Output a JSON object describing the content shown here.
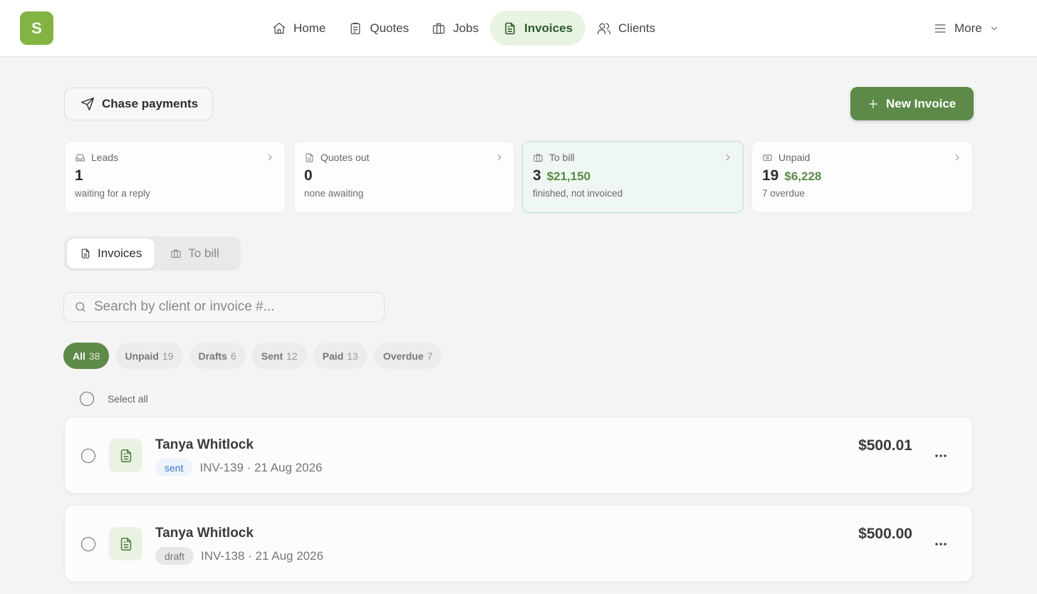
{
  "app": {
    "logo_letter": "S",
    "brand_color": "#83b443",
    "accent": "#5d8a48"
  },
  "nav": {
    "items": [
      {
        "label": "Home",
        "icon": "home-icon"
      },
      {
        "label": "Quotes",
        "icon": "clipboard-icon"
      },
      {
        "label": "Jobs",
        "icon": "briefcase-icon"
      },
      {
        "label": "Invoices",
        "icon": "invoice-icon",
        "active": true
      },
      {
        "label": "Clients",
        "icon": "users-icon"
      }
    ],
    "more_label": "More"
  },
  "actions": {
    "chase_label": "Chase payments",
    "new_invoice_label": "New Invoice"
  },
  "stats": [
    {
      "label": "Leads",
      "icon": "inbox-icon",
      "count": "1",
      "amount": "",
      "sub": "waiting for a reply"
    },
    {
      "label": "Quotes out",
      "icon": "document-icon",
      "count": "0",
      "amount": "",
      "sub": "none awaiting"
    },
    {
      "label": "To bill",
      "icon": "briefcase-icon",
      "count": "3",
      "amount": "$21,150",
      "sub": "finished, not invoiced",
      "highlighted": true
    },
    {
      "label": "Unpaid",
      "icon": "cash-icon",
      "count": "19",
      "amount": "$6,228",
      "sub": "7 overdue"
    }
  ],
  "tabs": [
    {
      "label": "Invoices",
      "icon": "invoice-icon",
      "active": true
    },
    {
      "label": "To bill",
      "icon": "briefcase-icon"
    }
  ],
  "search": {
    "placeholder": "Search by client or invoice #...",
    "value": ""
  },
  "filters": [
    {
      "label": "All",
      "count": "38",
      "active": true
    },
    {
      "label": "Unpaid",
      "count": "19"
    },
    {
      "label": "Drafts",
      "count": "6"
    },
    {
      "label": "Sent",
      "count": "12"
    },
    {
      "label": "Paid",
      "count": "13"
    },
    {
      "label": "Overdue",
      "count": "7"
    }
  ],
  "select_all_label": "Select all",
  "invoices": [
    {
      "client": "Tanya Whitlock",
      "status": "sent",
      "number": "INV-139",
      "date": "21 Aug 2026",
      "meta": "INV-139 · 21 Aug 2026",
      "amount": "$500.01"
    },
    {
      "client": "Tanya Whitlock",
      "status": "draft",
      "number": "INV-138",
      "date": "21 Aug 2026",
      "meta": "INV-138 · 21 Aug 2026",
      "amount": "$500.00"
    }
  ]
}
